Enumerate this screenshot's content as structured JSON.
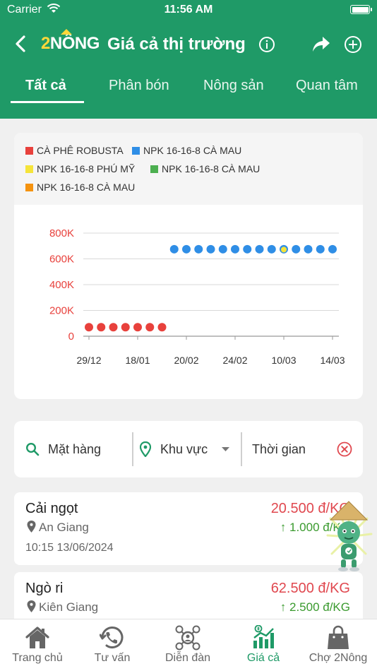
{
  "status": {
    "carrier": "Carrier",
    "time": "11:56 AM"
  },
  "header": {
    "logo_two": "2",
    "logo_nong": "NÔNG",
    "title": "Giá cả thị trường"
  },
  "tabs": [
    {
      "label": "Tất cả",
      "active": true
    },
    {
      "label": "Phân bón",
      "active": false
    },
    {
      "label": "Nông sản",
      "active": false
    },
    {
      "label": "Quan tâm",
      "active": false
    }
  ],
  "chart_data": {
    "type": "scatter",
    "legend": [
      {
        "name": "CÀ PHÊ ROBUSTA",
        "color": "#e8413c"
      },
      {
        "name": "NPK 16-16-8 CÀ MAU",
        "color": "#2f8ee6"
      },
      {
        "name": "NPK 16-16-8 PHÚ MỸ",
        "color": "#f5e43a"
      },
      {
        "name": "NPK 16-16-8 CÀ MAU",
        "color": "#4caf50"
      },
      {
        "name": "NPK 16-16-8 CÀ MAU",
        "color": "#f5930f"
      }
    ],
    "x_tick_labels": [
      "29/12",
      "18/01",
      "20/02",
      "24/02",
      "10/03",
      "14/03"
    ],
    "y_tick_labels": [
      "0",
      "200K",
      "400K",
      "600K",
      "800K"
    ],
    "ylim": [
      0,
      800000
    ],
    "grid": true,
    "series": [
      {
        "name": "CÀ PHÊ ROBUSTA",
        "color": "#e8413c",
        "points": [
          {
            "x": 0.0,
            "y": 70000
          },
          {
            "x": 0.25,
            "y": 70000
          },
          {
            "x": 0.5,
            "y": 70000
          },
          {
            "x": 0.75,
            "y": 70000
          },
          {
            "x": 1.0,
            "y": 70000
          },
          {
            "x": 1.25,
            "y": 70000
          },
          {
            "x": 1.5,
            "y": 70000
          }
        ]
      },
      {
        "name": "NPK 16-16-8 CÀ MAU",
        "color": "#2f8ee6",
        "points": [
          {
            "x": 1.75,
            "y": 675000
          },
          {
            "x": 2.0,
            "y": 675000
          },
          {
            "x": 2.25,
            "y": 675000
          },
          {
            "x": 2.5,
            "y": 675000
          },
          {
            "x": 2.75,
            "y": 675000
          },
          {
            "x": 3.0,
            "y": 675000
          },
          {
            "x": 3.25,
            "y": 675000
          },
          {
            "x": 3.5,
            "y": 675000
          },
          {
            "x": 3.75,
            "y": 675000
          },
          {
            "x": 4.0,
            "y": 675000
          },
          {
            "x": 4.25,
            "y": 675000
          },
          {
            "x": 4.5,
            "y": 675000
          },
          {
            "x": 4.75,
            "y": 675000
          },
          {
            "x": 5.0,
            "y": 675000
          }
        ]
      },
      {
        "name": "NPK 16-16-8 PHÚ MỸ",
        "color": "#f5e43a",
        "points": [
          {
            "x": 4.0,
            "y": 672000
          }
        ]
      }
    ]
  },
  "filters": {
    "product": "Mặt hàng",
    "region": "Khu vực",
    "time": "Thời gian"
  },
  "items": [
    {
      "name": "Cải ngọt",
      "location": "An Giang",
      "time": "10:15 13/06/2024",
      "price": "20.500 đ/KG",
      "change": "↑ 1.000 đ/KG"
    },
    {
      "name": "Ngò ri",
      "location": "Kiên Giang",
      "price": "62.500 đ/KG",
      "change": "↑ 2.500 đ/KG"
    }
  ],
  "bottom_nav": [
    {
      "label": "Trang chủ",
      "icon": "home-icon",
      "active": false
    },
    {
      "label": "Tư vấn",
      "icon": "phone-consult-icon",
      "active": false
    },
    {
      "label": "Diễn đàn",
      "icon": "forum-icon",
      "active": false
    },
    {
      "label": "Giá cả",
      "icon": "price-chart-icon",
      "active": true
    },
    {
      "label": "Chợ 2Nông",
      "icon": "shopping-bag-icon",
      "active": false
    }
  ],
  "colors": {
    "brand": "#1f9a67",
    "price": "#e0484f",
    "increase": "#3a9a2e"
  }
}
